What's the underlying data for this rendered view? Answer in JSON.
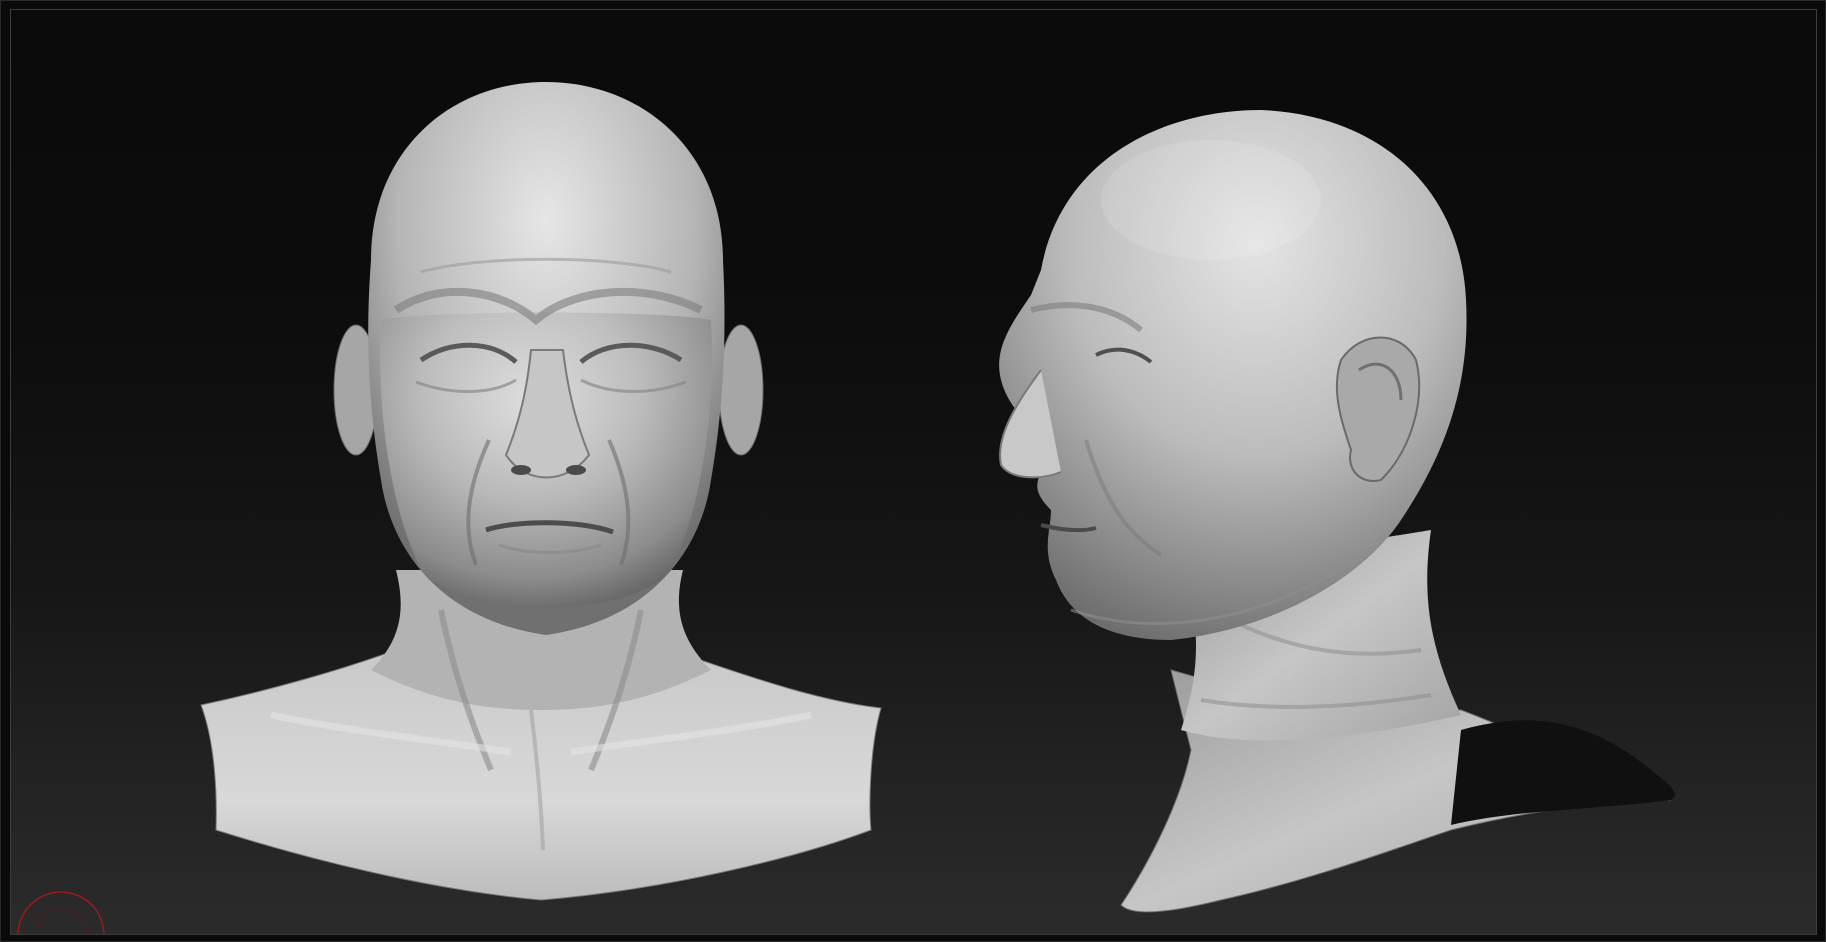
{
  "app": {
    "type": "3d-sculpting-viewport"
  },
  "viewport": {
    "background_top": "#0a0a0a",
    "background_bottom": "#2b2b2b",
    "frame_border": "#3c3c3c"
  },
  "models": [
    {
      "view": "front",
      "material": "matcap-gray",
      "color": "#b8b8b8"
    },
    {
      "view": "side-profile",
      "material": "matcap-gray",
      "color": "#b8b8b8"
    }
  ],
  "gizmo": {
    "icon": "orientation-gizmo-icon",
    "color": "#b01818"
  }
}
